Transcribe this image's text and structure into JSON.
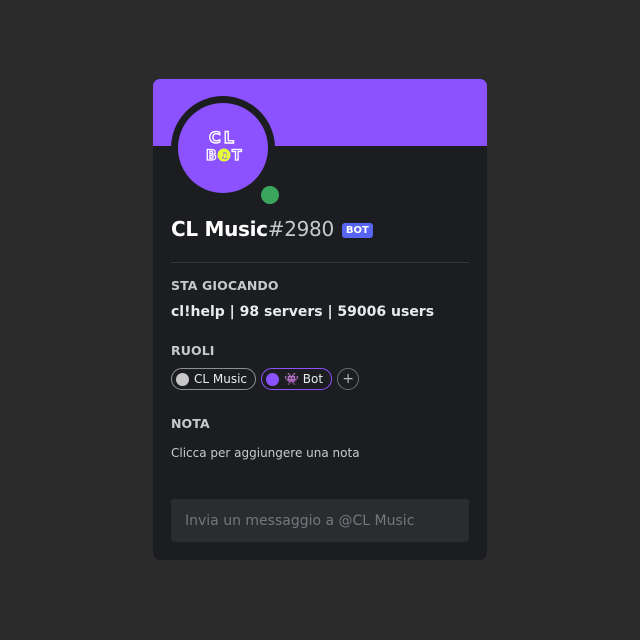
{
  "profile": {
    "username": "CL Music",
    "discriminator": "#2980",
    "tag": "BOT",
    "status": "online",
    "avatar_text": {
      "line1": "CL",
      "line2": "BOT"
    }
  },
  "activity": {
    "title": "STA GIOCANDO",
    "text": "cl!help | 98 servers | 59006 users"
  },
  "roles": {
    "title": "RUOLI",
    "items": [
      {
        "label": "CL Music",
        "color": "#c8c8c8"
      },
      {
        "label": "👾 Bot",
        "color": "#8c52ff"
      }
    ],
    "add_label": "+"
  },
  "note": {
    "title": "NOTA",
    "hint": "Clicca per aggiungere una nota"
  },
  "message": {
    "placeholder": "Invia un messaggio a @CL Music"
  },
  "colors": {
    "accent": "#8c52ff",
    "online": "#3ba55d",
    "bot_tag": "#5865f2",
    "logo_yellow": "#e4ff3a"
  }
}
